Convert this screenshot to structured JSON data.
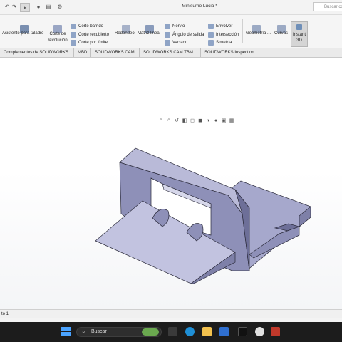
{
  "window": {
    "title": "Minisumo Lucia *",
    "search_placeholder": "Buscar co"
  },
  "ribbon": {
    "items": [
      "Asistente para taladro",
      "Corte de revolución",
      "Corte barrido",
      "Corte recubierto",
      "Corte por límite",
      "Redondeo",
      "Matriz lineal",
      "Nervio",
      "Ángulo de salida",
      "Vaciado",
      "Envolver",
      "Intersección",
      "Simetría",
      "Geometría ...",
      "Curvas",
      "Instant 3D"
    ]
  },
  "tabs": [
    "Complementos de SOLIDWORKS",
    "MBD",
    "SOLIDWORKS CAM",
    "SOLIDWORKS CAM TBM",
    "SOLIDWORKS Inspection"
  ],
  "status": {
    "text": "to 1"
  },
  "taskbar": {
    "search_label": "Buscar"
  },
  "icons": {
    "model_face_light": "#b8b9d6",
    "model_face_mid": "#8e90b8",
    "model_face_dark": "#6d6f98",
    "edge": "#2a2a3a"
  }
}
